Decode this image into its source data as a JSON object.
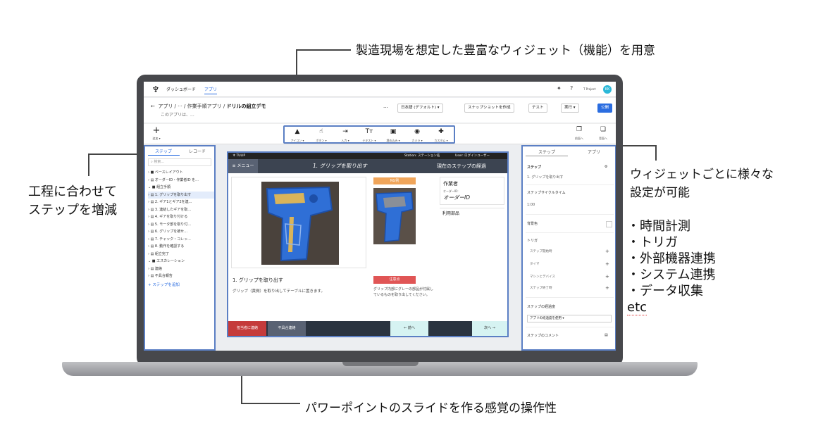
{
  "callouts": {
    "top": "製造現場を想定した豊富なウィジェット（機能）を用意",
    "left_line1": "工程に合わせて",
    "left_line2": "ステップを増減",
    "right_line1": "ウィジェットごとに様々な",
    "right_line2": "設定が可能",
    "right_bullets": [
      "・時間計測",
      "・トリガ",
      "・外部機器連携",
      "・システム連携",
      "・データ収集"
    ],
    "right_etc": "etc",
    "bottom": "パワーポイントのスライドを作る感覚の操作性"
  },
  "app": {
    "logo": "♆",
    "nav_dashboard": "ダッシュボード",
    "nav_app": "アプリ",
    "user_label": "T Project",
    "avatar": "KK",
    "breadcrumb_app": "アプリ",
    "breadcrumb_more": "···",
    "breadcrumb_folder": "作業手順アプリ",
    "breadcrumb_current": "ドリルの組立デモ",
    "description": "このアプリは、...",
    "more_btn": "···",
    "lang_btn": "日本語 (デフォルト) ▾",
    "snapshot_btn": "スナップショットを作成",
    "test_btn": "テスト",
    "run_btn": "実行 ▾",
    "publish_btn": "公開"
  },
  "toolbar": {
    "add_label": "追加 ▾",
    "tools": [
      {
        "icon": "▲",
        "label": "アイコン ▾"
      },
      {
        "icon": "☝",
        "label": "ボタン ▾"
      },
      {
        "icon": "⇥",
        "label": "入力 ▾"
      },
      {
        "icon": "Tт",
        "label": "テキスト ▾"
      },
      {
        "icon": "▣",
        "label": "埋め込み ▾"
      },
      {
        "icon": "◉",
        "label": "カメラ ▾"
      },
      {
        "icon": "✚",
        "label": "カスタム ▾"
      }
    ],
    "front_label": "前面へ",
    "back_label": "背面へ"
  },
  "left_panel": {
    "tab_steps": "ステップ",
    "tab_records": "レコード",
    "search_placeholder": "検索...",
    "tree": [
      "› ■ ベースレイアウト",
      "› ▤ オーダーID・作業者ID を...",
      "⌄ ■ 組立手順",
      "  › ▤ 1. グリップを取り出す",
      "  › ▤ 2. ギア1とギア2を連...",
      "  › ▤ 3. 連結したギアを取...",
      "  › ▤ 4. ギアを取り付ける",
      "  › ▤ 5. モータ部を取り付...",
      "  › ▤ 6. グリップを被せ...",
      "  › ▤ 7. チャック・コレッ...",
      "  › ▤ 8. 動作を確認する",
      "  › ▤ 組立完了",
      "⌄ ■ エスカレーション",
      "  › ▤ 連絡",
      "  › ▤ 不具合報告"
    ],
    "add_step": "+ ステップを追加"
  },
  "canvas": {
    "brand": "♆ TULIP",
    "station": "Station: ステーション名",
    "user": "User: ログインユーザー",
    "menu": "≡ メニュー",
    "title": "1. グリップを取り出す",
    "elapsed": "現在のステップの経過",
    "ng_label": "NG例",
    "worker_label": "作業者",
    "order_id": "オーダーID:",
    "order_value": "オーダーID",
    "parts_label": "利用部品",
    "step_title": "1. グリップを取り出す",
    "step_desc": "グリップ（黄側）を取り出してテーブルに置きます。",
    "caution_label": "注意点",
    "caution_text": "グリップ内部にグレーの部品が付属しているものを取り出してください。",
    "btn_contact": "担当者に連絡",
    "btn_defect": "不具合連絡",
    "btn_prev": "← 前へ",
    "btn_next": "次へ →"
  },
  "right_panel": {
    "tab_step": "ステップ",
    "tab_app": "アプリ",
    "step_heading": "ステップ",
    "step_value": "1. グリップを取り出す",
    "cycle_heading": "ステップサイクルタイム",
    "cycle_value": "1:00",
    "bg_heading": "背景色",
    "trigger_heading": "トリガ",
    "triggers": [
      "ステップ開始時",
      "タイマ",
      "マシンとデバイス",
      "ステップ終了時"
    ],
    "elapsed_heading": "ステップの経過度",
    "elapsed_select": "アプリの経過度を使用 ▾",
    "comment_heading": "ステップのコメント"
  },
  "colors": {
    "highlight": "#5b7fc4",
    "accent": "#2b6de0",
    "ng": "#f0a55a",
    "caution": "#e05555",
    "contact_btn": "#c53b3b"
  }
}
